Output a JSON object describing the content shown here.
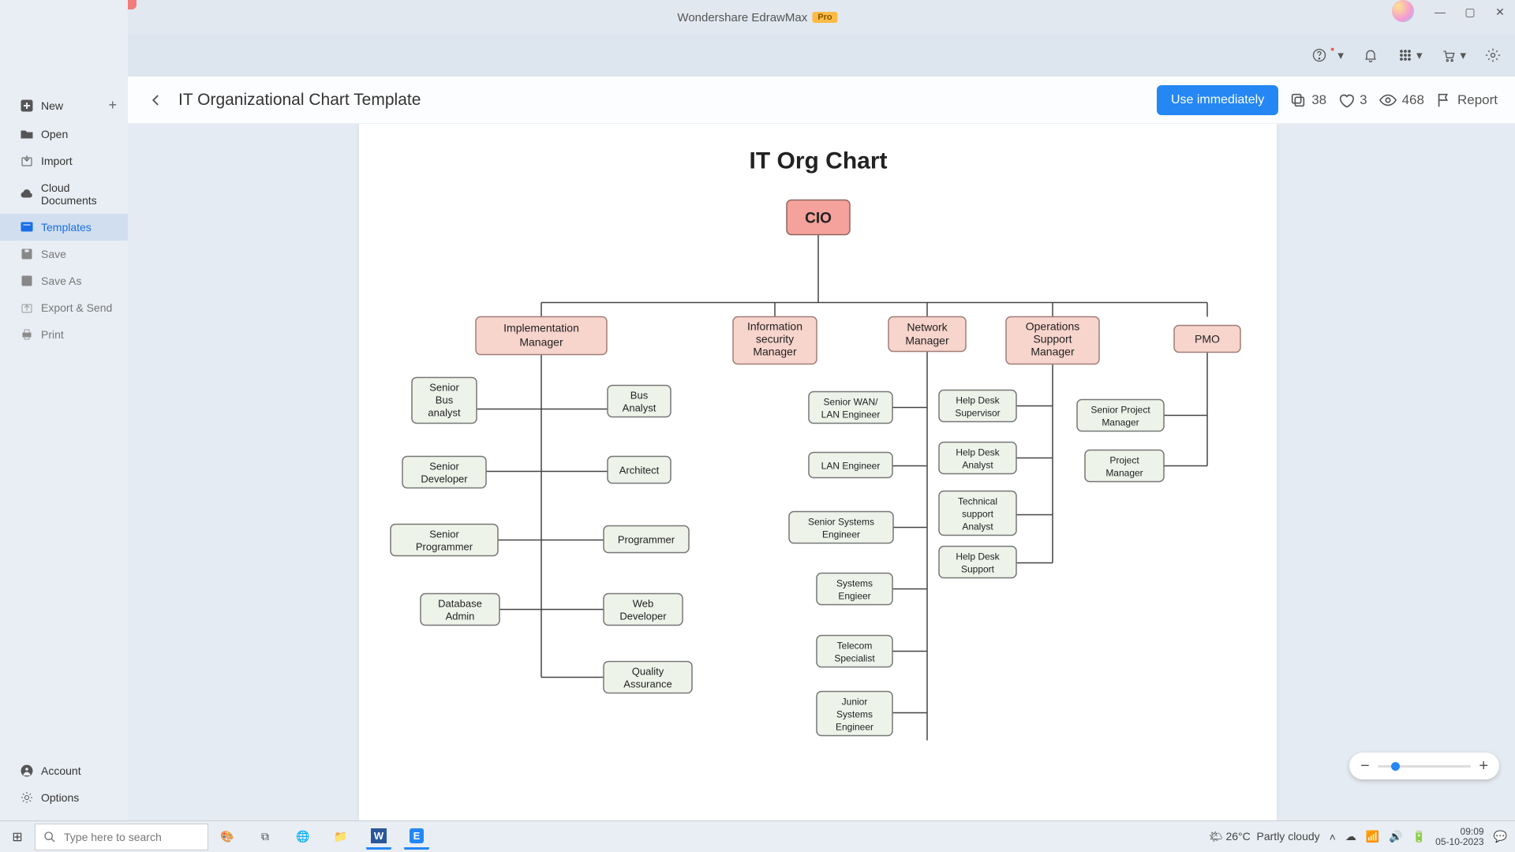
{
  "app": {
    "name": "Wondershare EdrawMax",
    "badge": "Pro"
  },
  "sidebar": {
    "items": [
      {
        "label": "New"
      },
      {
        "label": "Open"
      },
      {
        "label": "Import"
      },
      {
        "label": "Cloud Documents"
      },
      {
        "label": "Templates"
      },
      {
        "label": "Save"
      },
      {
        "label": "Save As"
      },
      {
        "label": "Export & Send"
      },
      {
        "label": "Print"
      }
    ],
    "account": "Account",
    "options": "Options"
  },
  "header": {
    "title": "IT Organizational Chart Template",
    "use": "Use immediately",
    "copies": "38",
    "likes": "3",
    "views": "468",
    "report": "Report"
  },
  "chart_data": {
    "type": "tree",
    "title": "IT Org Chart",
    "root": "CIO",
    "managers": [
      "Implementation Manager",
      "Information security Manager",
      "Network Manager",
      "Operations Support Manager",
      "PMO"
    ],
    "branches": {
      "Implementation Manager": {
        "left": [
          "Senior Bus analyst",
          "Senior Developer",
          "Senior Programmer",
          "Database Admin"
        ],
        "right": [
          "Bus Analyst",
          "Architect",
          "Programmer",
          "Web Developer",
          "Quality Assurance"
        ]
      },
      "Network Manager": {
        "left": [
          "Senior WAN/ LAN Engineer",
          "LAN Engineer",
          "Senior Systems Engineer",
          "Systems Engieer",
          "Telecom Specialist",
          "Junior Systems Engineer"
        ]
      },
      "Operations Support Manager": {
        "left": [
          "Help Desk Supervisor",
          "Help Desk Analyst",
          "Technical support Analyst",
          "Help Desk Support"
        ]
      },
      "PMO": {
        "left": [
          "Senior Project Manager",
          "Project Manager"
        ]
      }
    }
  },
  "taskbar": {
    "search_placeholder": "Type here to search",
    "weather_temp": "26°C",
    "weather_desc": "Partly cloudy",
    "time": "09:09",
    "date": "05-10-2023"
  }
}
